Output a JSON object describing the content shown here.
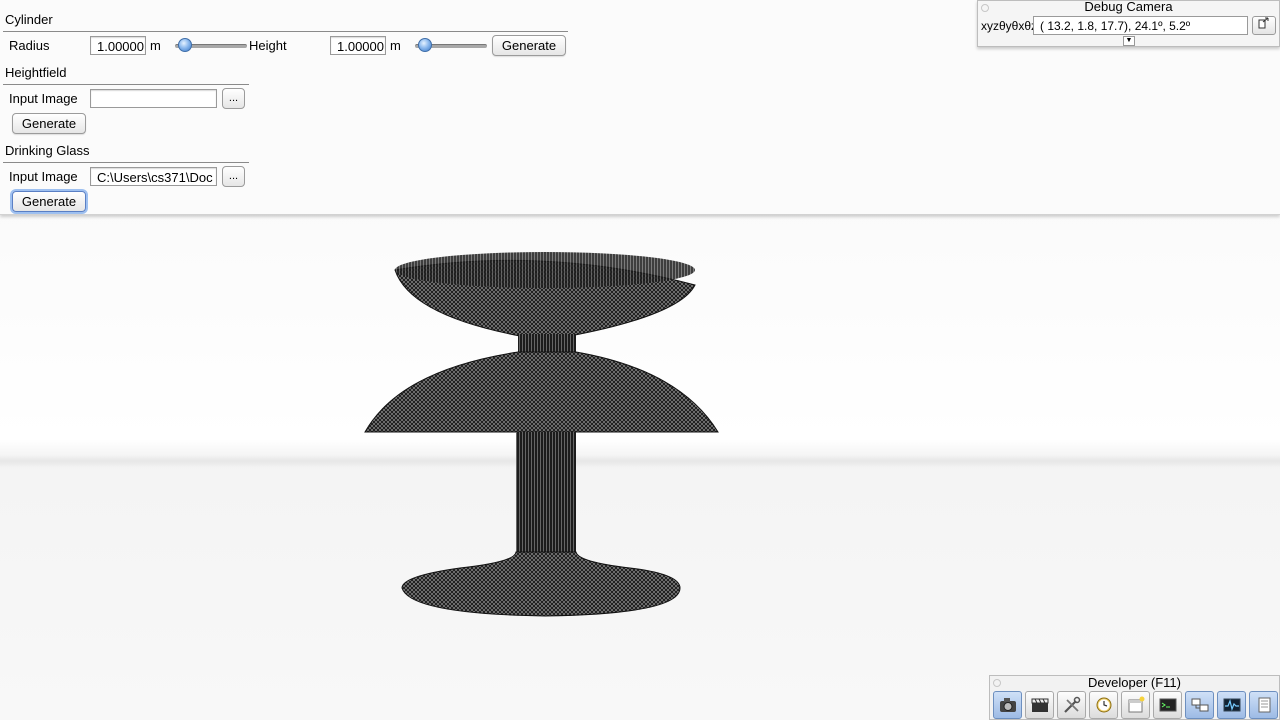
{
  "cylinder": {
    "title": "Cylinder",
    "radius_label": "Radius",
    "radius_value": "1.00000",
    "radius_unit": "m",
    "radius_slider": 0.05,
    "height_label": "Height",
    "height_value": "1.00000",
    "height_unit": "m",
    "height_slider": 0.05,
    "generate_label": "Generate"
  },
  "heightfield": {
    "title": "Heightfield",
    "input_label": "Input Image",
    "input_value": "",
    "browse_label": "...",
    "generate_label": "Generate"
  },
  "drinking_glass": {
    "title": "Drinking Glass",
    "input_label": "Input Image",
    "input_value": "C:\\Users\\cs371\\Doc",
    "browse_label": "...",
    "generate_label": "Generate"
  },
  "debug_camera": {
    "title": "Debug Camera",
    "coord_label": "xyzθyθxθz",
    "coord_value": "( 13.2,   1.8,  17.7),  24.1º,   5.2º"
  },
  "developer": {
    "title": "Developer (F11)",
    "tools": [
      {
        "name": "camera-icon",
        "active": true
      },
      {
        "name": "film-clapper-icon",
        "active": false
      },
      {
        "name": "tools-icon",
        "active": false
      },
      {
        "name": "clock-icon",
        "active": false
      },
      {
        "name": "new-window-icon",
        "active": false
      },
      {
        "name": "console-icon",
        "active": false
      },
      {
        "name": "scene-graph-icon",
        "active": true
      },
      {
        "name": "profiler-icon",
        "active": true
      },
      {
        "name": "document-icon",
        "active": true
      }
    ]
  },
  "colors": {
    "accent": "#5a7fc4",
    "slider_knob": "#3a78c8",
    "mesh": "#1a1a1a"
  }
}
